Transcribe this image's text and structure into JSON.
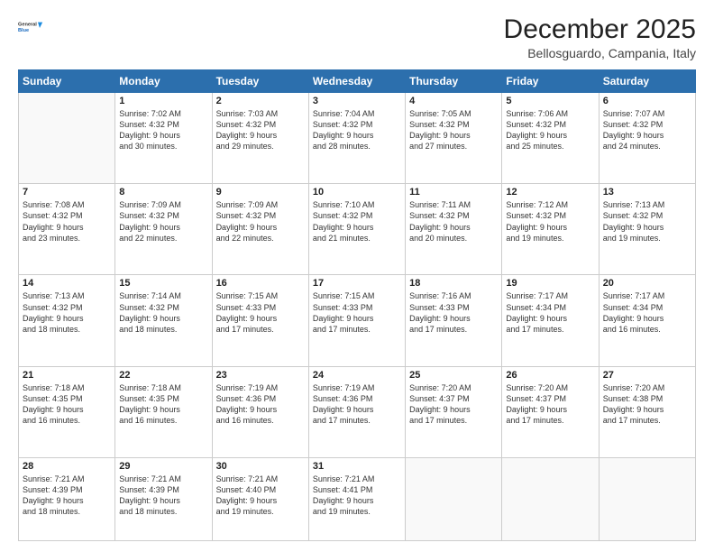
{
  "logo": {
    "line1": "General",
    "line2": "Blue"
  },
  "title": "December 2025",
  "location": "Bellosguardo, Campania, Italy",
  "weekdays": [
    "Sunday",
    "Monday",
    "Tuesday",
    "Wednesday",
    "Thursday",
    "Friday",
    "Saturday"
  ],
  "weeks": [
    [
      {
        "day": "",
        "info": ""
      },
      {
        "day": "1",
        "info": "Sunrise: 7:02 AM\nSunset: 4:32 PM\nDaylight: 9 hours\nand 30 minutes."
      },
      {
        "day": "2",
        "info": "Sunrise: 7:03 AM\nSunset: 4:32 PM\nDaylight: 9 hours\nand 29 minutes."
      },
      {
        "day": "3",
        "info": "Sunrise: 7:04 AM\nSunset: 4:32 PM\nDaylight: 9 hours\nand 28 minutes."
      },
      {
        "day": "4",
        "info": "Sunrise: 7:05 AM\nSunset: 4:32 PM\nDaylight: 9 hours\nand 27 minutes."
      },
      {
        "day": "5",
        "info": "Sunrise: 7:06 AM\nSunset: 4:32 PM\nDaylight: 9 hours\nand 25 minutes."
      },
      {
        "day": "6",
        "info": "Sunrise: 7:07 AM\nSunset: 4:32 PM\nDaylight: 9 hours\nand 24 minutes."
      }
    ],
    [
      {
        "day": "7",
        "info": "Sunrise: 7:08 AM\nSunset: 4:32 PM\nDaylight: 9 hours\nand 23 minutes."
      },
      {
        "day": "8",
        "info": "Sunrise: 7:09 AM\nSunset: 4:32 PM\nDaylight: 9 hours\nand 22 minutes."
      },
      {
        "day": "9",
        "info": "Sunrise: 7:09 AM\nSunset: 4:32 PM\nDaylight: 9 hours\nand 22 minutes."
      },
      {
        "day": "10",
        "info": "Sunrise: 7:10 AM\nSunset: 4:32 PM\nDaylight: 9 hours\nand 21 minutes."
      },
      {
        "day": "11",
        "info": "Sunrise: 7:11 AM\nSunset: 4:32 PM\nDaylight: 9 hours\nand 20 minutes."
      },
      {
        "day": "12",
        "info": "Sunrise: 7:12 AM\nSunset: 4:32 PM\nDaylight: 9 hours\nand 19 minutes."
      },
      {
        "day": "13",
        "info": "Sunrise: 7:13 AM\nSunset: 4:32 PM\nDaylight: 9 hours\nand 19 minutes."
      }
    ],
    [
      {
        "day": "14",
        "info": "Sunrise: 7:13 AM\nSunset: 4:32 PM\nDaylight: 9 hours\nand 18 minutes."
      },
      {
        "day": "15",
        "info": "Sunrise: 7:14 AM\nSunset: 4:32 PM\nDaylight: 9 hours\nand 18 minutes."
      },
      {
        "day": "16",
        "info": "Sunrise: 7:15 AM\nSunset: 4:33 PM\nDaylight: 9 hours\nand 17 minutes."
      },
      {
        "day": "17",
        "info": "Sunrise: 7:15 AM\nSunset: 4:33 PM\nDaylight: 9 hours\nand 17 minutes."
      },
      {
        "day": "18",
        "info": "Sunrise: 7:16 AM\nSunset: 4:33 PM\nDaylight: 9 hours\nand 17 minutes."
      },
      {
        "day": "19",
        "info": "Sunrise: 7:17 AM\nSunset: 4:34 PM\nDaylight: 9 hours\nand 17 minutes."
      },
      {
        "day": "20",
        "info": "Sunrise: 7:17 AM\nSunset: 4:34 PM\nDaylight: 9 hours\nand 16 minutes."
      }
    ],
    [
      {
        "day": "21",
        "info": "Sunrise: 7:18 AM\nSunset: 4:35 PM\nDaylight: 9 hours\nand 16 minutes."
      },
      {
        "day": "22",
        "info": "Sunrise: 7:18 AM\nSunset: 4:35 PM\nDaylight: 9 hours\nand 16 minutes."
      },
      {
        "day": "23",
        "info": "Sunrise: 7:19 AM\nSunset: 4:36 PM\nDaylight: 9 hours\nand 16 minutes."
      },
      {
        "day": "24",
        "info": "Sunrise: 7:19 AM\nSunset: 4:36 PM\nDaylight: 9 hours\nand 17 minutes."
      },
      {
        "day": "25",
        "info": "Sunrise: 7:20 AM\nSunset: 4:37 PM\nDaylight: 9 hours\nand 17 minutes."
      },
      {
        "day": "26",
        "info": "Sunrise: 7:20 AM\nSunset: 4:37 PM\nDaylight: 9 hours\nand 17 minutes."
      },
      {
        "day": "27",
        "info": "Sunrise: 7:20 AM\nSunset: 4:38 PM\nDaylight: 9 hours\nand 17 minutes."
      }
    ],
    [
      {
        "day": "28",
        "info": "Sunrise: 7:21 AM\nSunset: 4:39 PM\nDaylight: 9 hours\nand 18 minutes."
      },
      {
        "day": "29",
        "info": "Sunrise: 7:21 AM\nSunset: 4:39 PM\nDaylight: 9 hours\nand 18 minutes."
      },
      {
        "day": "30",
        "info": "Sunrise: 7:21 AM\nSunset: 4:40 PM\nDaylight: 9 hours\nand 19 minutes."
      },
      {
        "day": "31",
        "info": "Sunrise: 7:21 AM\nSunset: 4:41 PM\nDaylight: 9 hours\nand 19 minutes."
      },
      {
        "day": "",
        "info": ""
      },
      {
        "day": "",
        "info": ""
      },
      {
        "day": "",
        "info": ""
      }
    ]
  ]
}
